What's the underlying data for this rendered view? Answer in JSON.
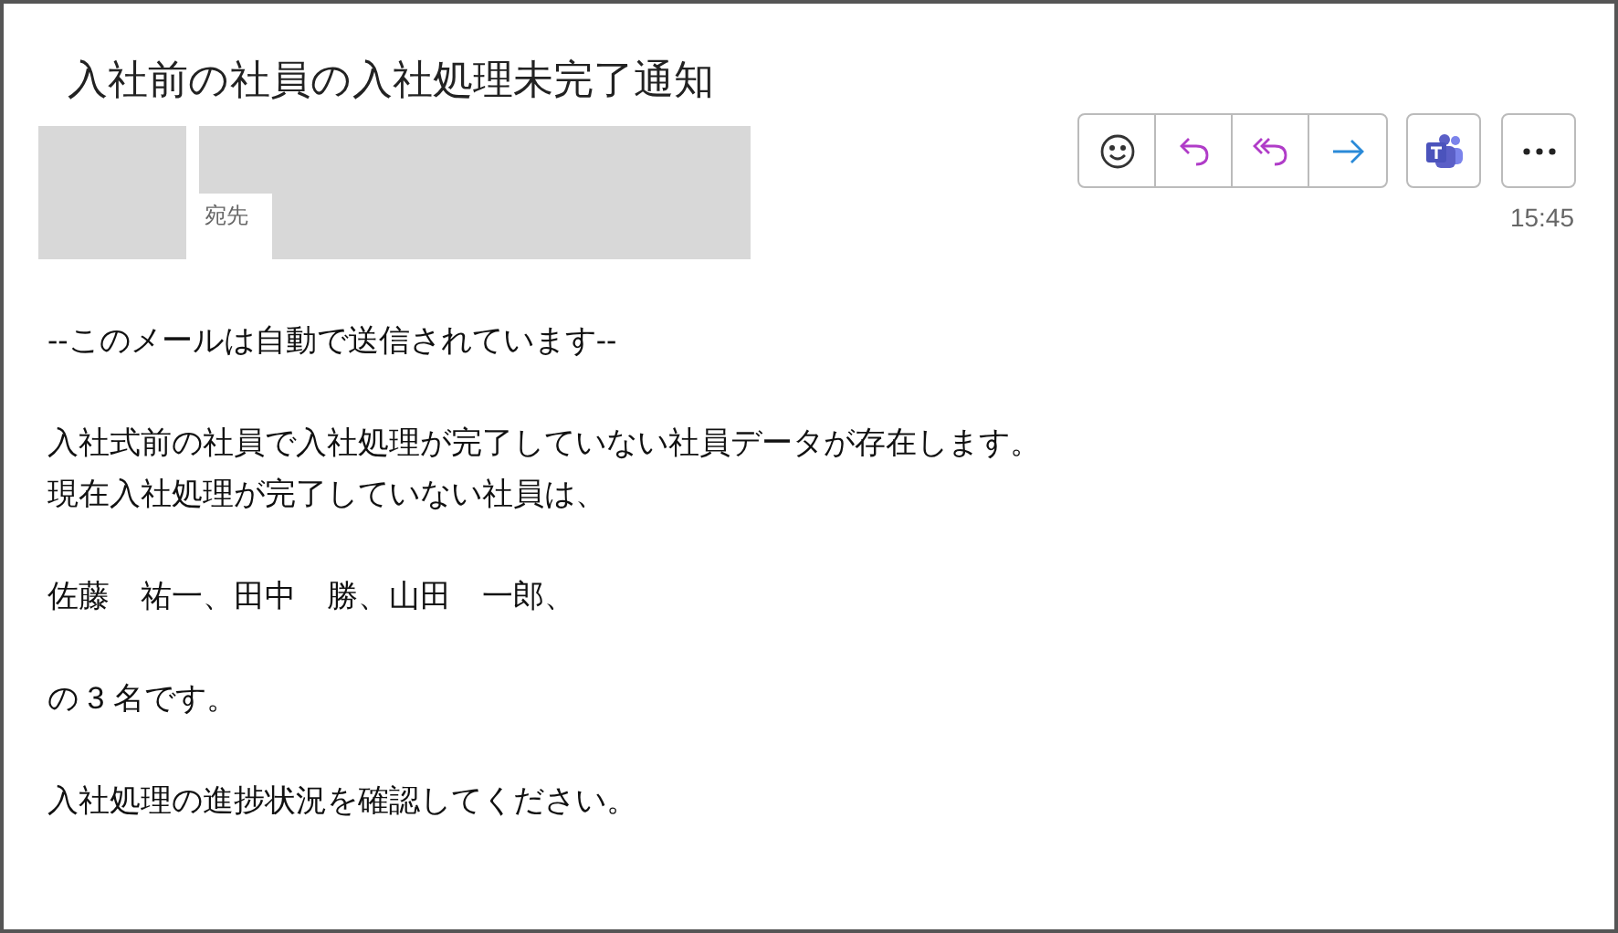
{
  "subject": "入社前の社員の入社処理未完了通知",
  "header": {
    "to_label": "宛先",
    "time": "15:45"
  },
  "body": {
    "paragraphs": [
      [
        "--このメールは自動で送信されています--"
      ],
      [
        "入社式前の社員で入社処理が完了していない社員データが存在します。",
        "現在入社処理が完了していない社員は、"
      ],
      [
        "佐藤　祐一、田中　勝、山田　一郎、"
      ],
      [
        "の 3 名です。"
      ],
      [
        "入社処理の進捗状況を確認してください。"
      ]
    ]
  }
}
